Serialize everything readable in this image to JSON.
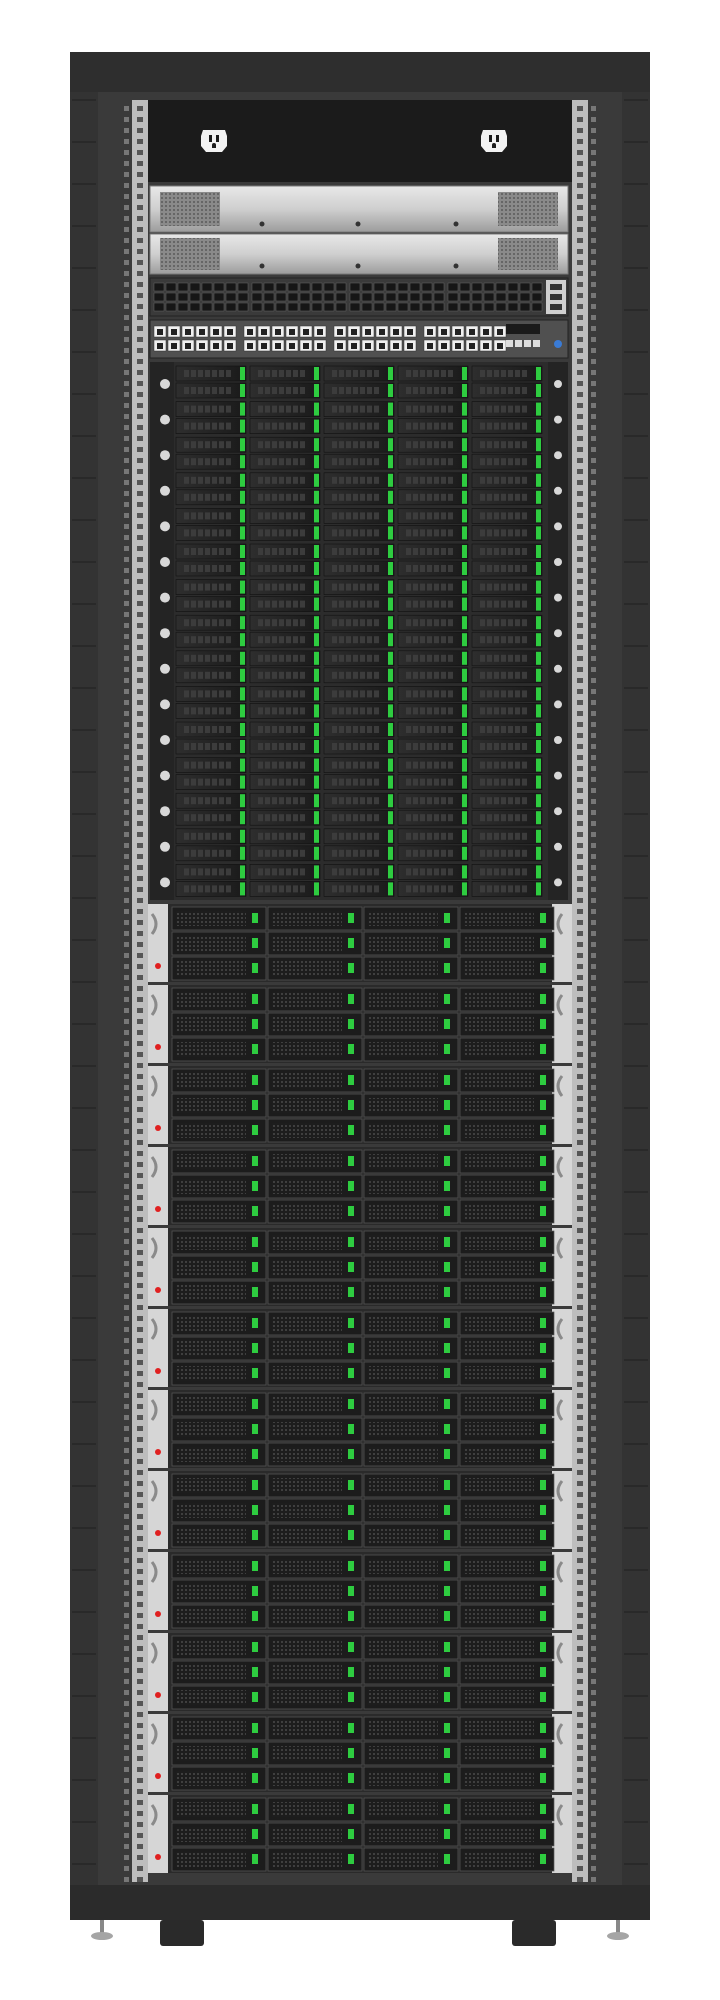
{
  "rack": {
    "colors": {
      "cabinet": "#3a3a3a",
      "cabinet_dark": "#2b2b2b",
      "rail": "#bdbdbd",
      "bay_bg": "#303030",
      "drive_face": "#1c1c1c",
      "accent_green": "#2ecc40",
      "status_red": "#e02020",
      "silver": "#cfcfcf"
    },
    "icons": [
      "power-outlet-icon"
    ],
    "sections": {
      "pdu_outlets": 2,
      "top_2u_servers": 2,
      "qsfp_switches": 1,
      "ethernet_switches": 1,
      "blade_rows": 15,
      "blade_columns": 5,
      "storage_units": 12,
      "storage_columns": 4
    }
  }
}
